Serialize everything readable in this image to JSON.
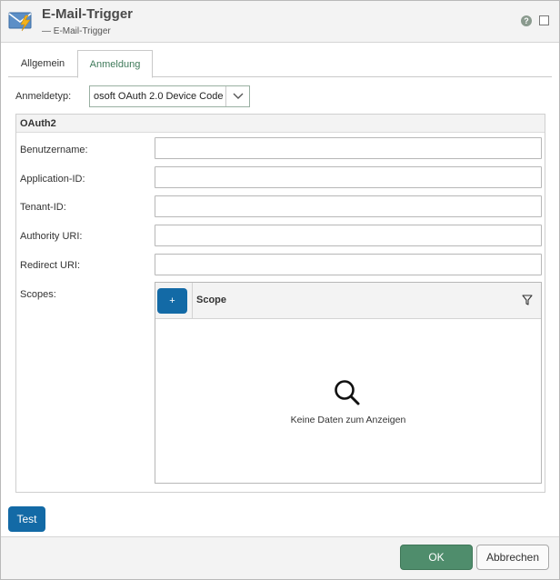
{
  "window": {
    "title": "E-Mail-Trigger",
    "subtitle": "— E-Mail-Trigger",
    "app_icon": "envelope-lightning-icon",
    "help_icon": "help-icon",
    "help_symbol": "?",
    "maximize_icon": "maximize-icon"
  },
  "tabs": [
    {
      "label": "Allgemein",
      "active": false
    },
    {
      "label": "Anmeldung",
      "active": true
    }
  ],
  "anmeldetyp": {
    "label": "Anmeldetyp:",
    "value": "osoft OAuth 2.0 Device Code",
    "dropdown_icon": "chevron-down-icon"
  },
  "oauth2": {
    "title": "OAuth2",
    "fields": [
      {
        "label": "Benutzername:",
        "value": ""
      },
      {
        "label": "Application-ID:",
        "value": ""
      },
      {
        "label": "Tenant-ID:",
        "value": ""
      },
      {
        "label": "Authority URI:",
        "value": ""
      },
      {
        "label": "Redirect URI:",
        "value": ""
      }
    ],
    "scopes": {
      "label": "Scopes:",
      "add_button": "+",
      "column": "Scope",
      "filter_icon": "filter-icon",
      "empty_icon": "search-icon",
      "empty_text": "Keine Daten zum Anzeigen"
    }
  },
  "test_button": "Test",
  "footer": {
    "ok": "OK",
    "cancel": "Abbrechen"
  },
  "colors": {
    "primary_blue": "#136aa6",
    "ok_green": "#4f8d6c",
    "tab_active_text": "#3f7a5a",
    "header_bg": "#f3f3f3"
  }
}
